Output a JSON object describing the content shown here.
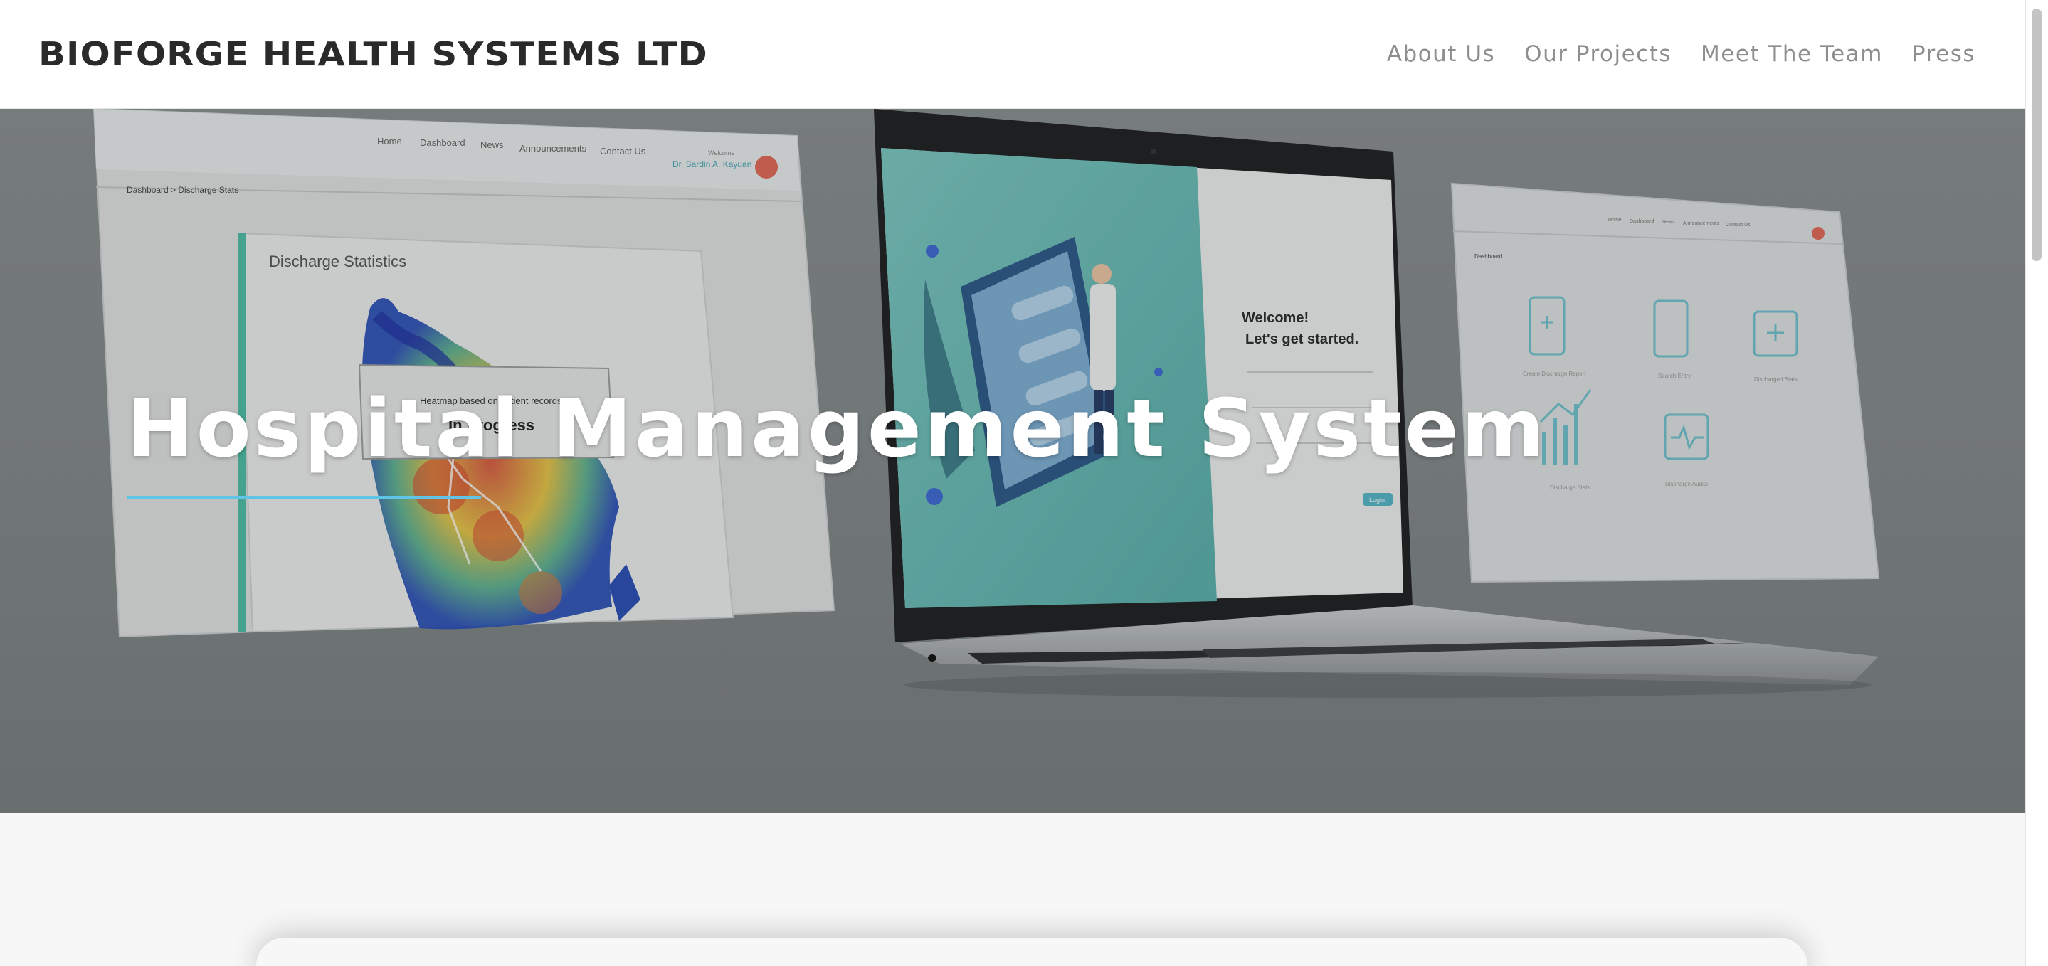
{
  "header": {
    "logo": "BIOFORGE HEALTH SYSTEMS LTD",
    "nav": [
      "About Us",
      "Our Projects",
      "Meet The Team",
      "Press"
    ]
  },
  "hero": {
    "title": "Hospital Management System",
    "accent_color": "#5fc4e6",
    "background_mockups": {
      "left_screen": {
        "nav": [
          "Home",
          "Dashboard",
          "News",
          "Announcements",
          "Contact Us"
        ],
        "user_greeting": "Welcome",
        "user_name": "Dr. Sardin A. Kayuan",
        "breadcrumb": "Dashboard > Discharge Stats",
        "panel_title": "Discharge Statistics",
        "overlay_note": "Heatmap based on patient records",
        "overlay_status": "In Progress"
      },
      "laptop_screen": {
        "heading_line1": "Welcome!",
        "heading_line2": "Let's get started.",
        "button": "Login"
      },
      "right_screen": {
        "nav": [
          "Home",
          "Dashboard",
          "News",
          "Announcements",
          "Contact Us"
        ],
        "section": "Dashboard",
        "tiles": [
          "Create Discharge Report",
          "Search Entry",
          "Discharged Stats",
          "Discharge Stats",
          "Discharge Audits"
        ]
      }
    }
  }
}
